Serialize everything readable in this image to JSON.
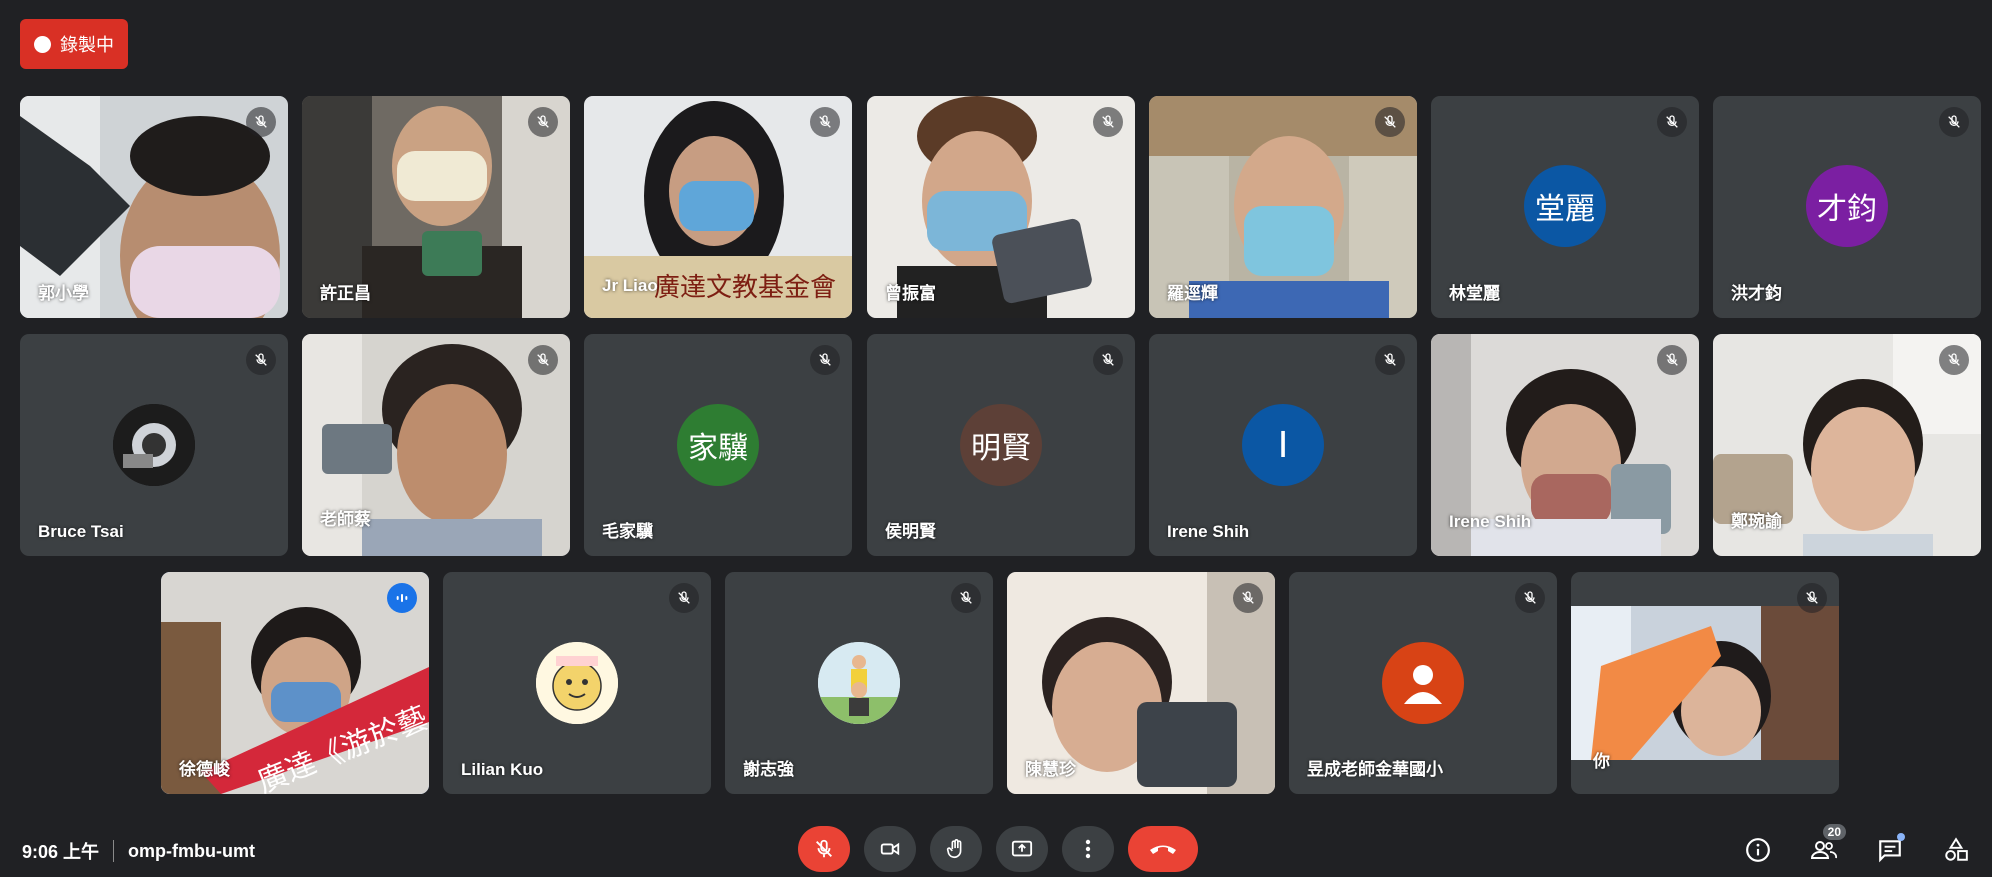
{
  "recording": {
    "label": "錄製中",
    "dot_color": "#ffffff",
    "bg": "#d93025"
  },
  "participants": [
    {
      "name": "郭小學",
      "kind": "video",
      "muted": true
    },
    {
      "name": "許正昌",
      "kind": "video",
      "muted": true
    },
    {
      "name": "Jr Liao",
      "kind": "video",
      "muted": true
    },
    {
      "name": "曾振富",
      "kind": "video",
      "muted": true
    },
    {
      "name": "羅逕輝",
      "kind": "video",
      "muted": true
    },
    {
      "name": "林堂麗",
      "kind": "avatar",
      "initials": "堂麗",
      "avatar_color": "#0b57a4",
      "muted": true
    },
    {
      "name": "洪才鈞",
      "kind": "avatar",
      "initials": "才鈞",
      "avatar_color": "#7b1fa2",
      "muted": true
    },
    {
      "name": "Bruce Tsai",
      "kind": "photo-avatar",
      "muted": true
    },
    {
      "name": "老師蔡",
      "kind": "video",
      "muted": true
    },
    {
      "name": "毛家驥",
      "kind": "avatar",
      "initials": "家驥",
      "avatar_color": "#2e7d32",
      "muted": true
    },
    {
      "name": "侯明賢",
      "kind": "avatar",
      "initials": "明賢",
      "avatar_color": "#5d4037",
      "muted": true
    },
    {
      "name": "Irene Shih",
      "kind": "avatar",
      "initials": "I",
      "avatar_color": "#0b57a4",
      "muted": true
    },
    {
      "name": "Irene Shih",
      "kind": "video",
      "muted": true
    },
    {
      "name": "鄭琬諭",
      "kind": "video",
      "muted": true
    },
    {
      "name": "徐德峻",
      "kind": "video",
      "muted": false,
      "speaking": true
    },
    {
      "name": "Lilian Kuo",
      "kind": "photo-avatar",
      "muted": true
    },
    {
      "name": "謝志強",
      "kind": "photo-avatar",
      "muted": true
    },
    {
      "name": "陳慧珍",
      "kind": "video",
      "muted": true
    },
    {
      "name": "昱成老師金華國小",
      "kind": "avatar",
      "initials": "",
      "avatar_color": "#d84315",
      "muted": true
    },
    {
      "name": "你",
      "kind": "video",
      "muted": true
    }
  ],
  "footer": {
    "time": "9:06 上午",
    "meeting_code": "omp-fmbu-umt",
    "participant_count": "20"
  },
  "controls": {
    "icons": [
      "mic-off-icon",
      "camera-icon",
      "raise-hand-icon",
      "present-screen-icon",
      "more-options-icon",
      "end-call-icon"
    ]
  },
  "right_panel": {
    "icons": [
      "info-icon",
      "people-icon",
      "chat-icon",
      "activities-icon"
    ]
  }
}
